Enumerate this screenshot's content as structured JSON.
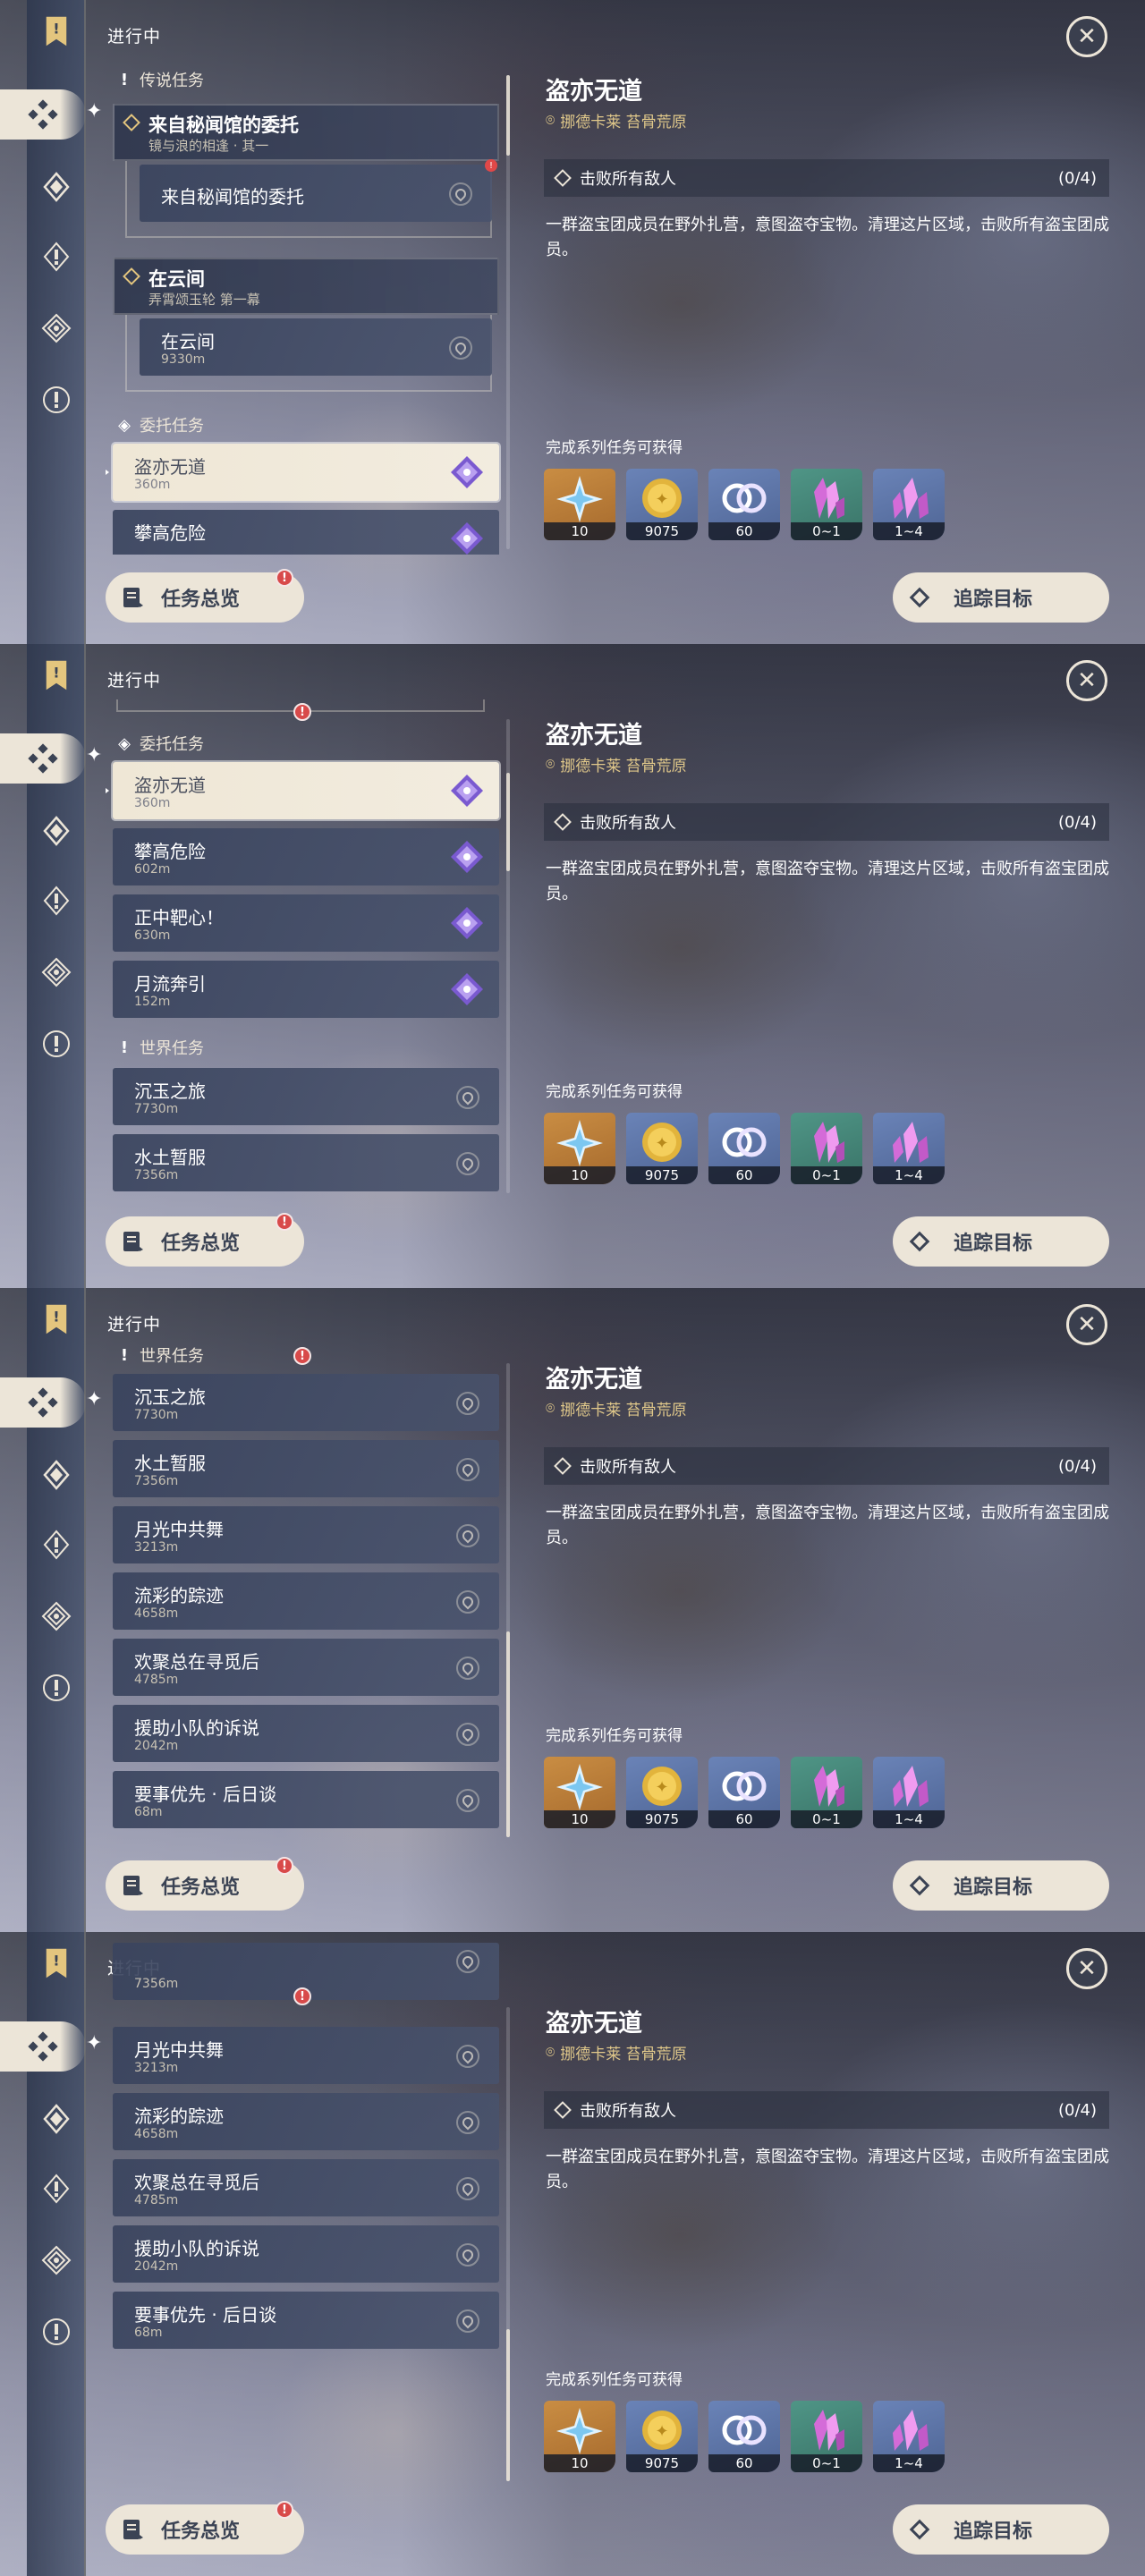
{
  "header": {
    "status": "进行中"
  },
  "sections": {
    "legend": "传说任务",
    "commission": "委托任务",
    "world": "世界任务"
  },
  "legend_quests": [
    {
      "title": "来自秘闻馆的委托",
      "subtitle": "镜与浪的相逢 · 其一",
      "child": "来自秘闻馆的委托"
    },
    {
      "title": "在云间",
      "subtitle": "弄霄颂玉轮 第一幕",
      "child": "在云间",
      "child_dist": "9330m"
    }
  ],
  "commissions": [
    {
      "title": "盗亦无道",
      "dist": "360m"
    },
    {
      "title": "攀高危险",
      "dist": "602m"
    },
    {
      "title": "正中靶心！",
      "dist": "630m"
    },
    {
      "title": "月流奔引",
      "dist": "152m"
    }
  ],
  "world_quests": [
    {
      "title": "沉玉之旅",
      "dist": "7730m"
    },
    {
      "title": "水土暂服",
      "dist": "7356m"
    },
    {
      "title": "月光中共舞",
      "dist": "3213m"
    },
    {
      "title": "流彩的踪迹",
      "dist": "4658m"
    },
    {
      "title": "欢聚总在寻觅后",
      "dist": "4785m"
    },
    {
      "title": "援助小队的诉说",
      "dist": "2042m"
    },
    {
      "title": "要事优先 · 后日谈",
      "dist": "68m"
    }
  ],
  "detail": {
    "title": "盗亦无道",
    "location": "挪德卡莱 苔骨荒原",
    "objective": "击败所有敌人",
    "progress": "(0/4)",
    "description": "一群盗宝团成员在野外扎营，意图盗夺宝物。清理这片区域，击败所有盗宝团成员。",
    "reward_label": "完成系列任务可获得",
    "rewards": [
      {
        "icon": "primogem-icon",
        "amount": "10",
        "bg": "gold"
      },
      {
        "icon": "mora-icon",
        "amount": "9075",
        "bg": "blue"
      },
      {
        "icon": "companionship-exp-icon",
        "amount": "60",
        "bg": "blue"
      },
      {
        "icon": "green-crystal-icon",
        "amount": "0~1",
        "bg": "green"
      },
      {
        "icon": "purple-crystal-icon",
        "amount": "1~4",
        "bg": "blue"
      }
    ]
  },
  "buttons": {
    "overview": "任务总览",
    "track": "追踪目标",
    "close": "✕"
  },
  "badge": "!",
  "colors": {
    "cream": "#ece5d8",
    "gold": "#e0c88a",
    "badge": "#d84a4a"
  }
}
